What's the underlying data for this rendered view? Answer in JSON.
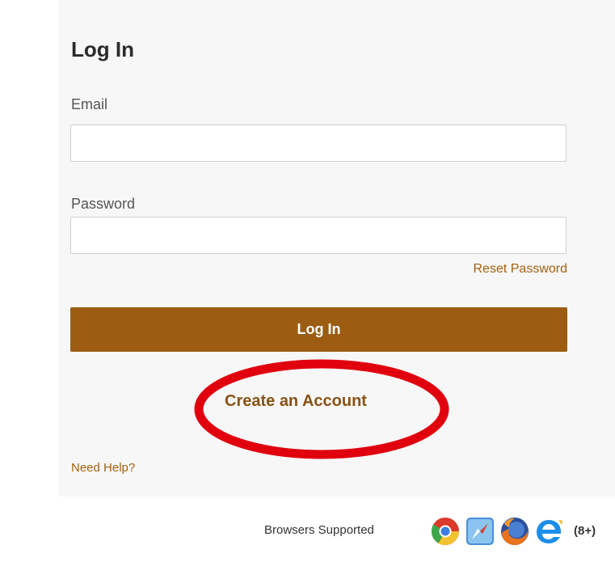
{
  "login_form": {
    "title": "Log In",
    "email_label": "Email",
    "email_value": "",
    "password_label": "Password",
    "password_value": "",
    "reset_password_link": "Reset Password",
    "login_button_label": "Log In",
    "create_account_link": "Create an Account",
    "need_help_link": "Need Help?"
  },
  "footer": {
    "browsers_supported_label": "Browsers Supported",
    "browser_icons": [
      "chrome-icon",
      "safari-icon",
      "firefox-icon",
      "internet-explorer-icon"
    ],
    "ie_version_note": "(8+)"
  },
  "colors": {
    "accent": "#9c5d12",
    "link": "#a46010",
    "annotation": "#e0000e"
  }
}
